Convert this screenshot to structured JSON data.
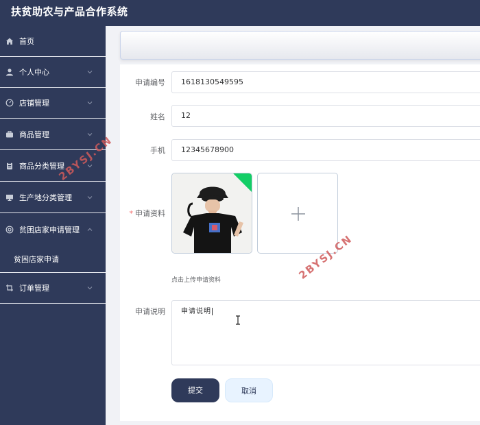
{
  "app": {
    "title": "扶贫助农与产品合作系统"
  },
  "sidebar": {
    "items": [
      {
        "label": "首页",
        "icon": "home-icon"
      },
      {
        "label": "个人中心",
        "icon": "user-icon"
      },
      {
        "label": "店铺管理",
        "icon": "dashboard-icon"
      },
      {
        "label": "商品管理",
        "icon": "briefcase-icon"
      },
      {
        "label": "商品分类管理",
        "icon": "clipboard-icon"
      },
      {
        "label": "生产地分类管理",
        "icon": "monitor-icon"
      },
      {
        "label": "贫困店家申请管理",
        "icon": "help-circle-icon"
      },
      {
        "label": "订单管理",
        "icon": "crop-icon"
      }
    ],
    "subitem": {
      "label": "贫困店家申请"
    }
  },
  "form": {
    "application_no": {
      "label": "申请编号",
      "value": "1618130549595"
    },
    "name": {
      "label": "姓名",
      "value": "12"
    },
    "phone": {
      "label": "手机",
      "value": "12345678900"
    },
    "materials": {
      "label": "申请资料",
      "tip": "点击上传申请资料"
    },
    "description": {
      "label": "申请说明",
      "value": "申请说明"
    },
    "submit_label": "提交",
    "cancel_label": "取消"
  },
  "watermark": {
    "text": "2BYSJ.CN"
  }
}
